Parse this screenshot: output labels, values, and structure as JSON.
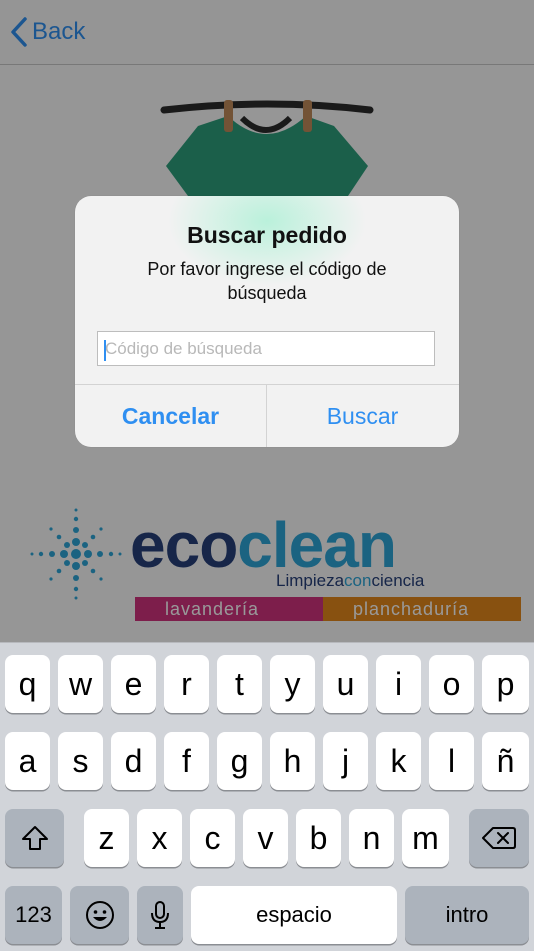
{
  "nav": {
    "back_label": "Back"
  },
  "brand": {
    "eco": "eco",
    "clean": "clean",
    "tagline_a": "Limpieza",
    "tagline_b": "con",
    "tagline_c": "ciencia",
    "band_left": "lavandería",
    "band_right": "planchaduría",
    "colors": {
      "navy": "#27407a",
      "cyan": "#2ea6d8",
      "magenta": "#d1337e",
      "orange": "#e3871c"
    }
  },
  "alert": {
    "title": "Buscar pedido",
    "message": "Por favor ingrese el código de búsqueda",
    "input_value": "",
    "input_placeholder": "Código de búsqueda",
    "cancel_label": "Cancelar",
    "search_label": "Buscar",
    "accent_color": "#2f8ff1"
  },
  "keyboard": {
    "row1": [
      "q",
      "w",
      "e",
      "r",
      "t",
      "y",
      "u",
      "i",
      "o",
      "p"
    ],
    "row2": [
      "a",
      "s",
      "d",
      "f",
      "g",
      "h",
      "j",
      "k",
      "l",
      "ñ"
    ],
    "row3": [
      "z",
      "x",
      "c",
      "v",
      "b",
      "n",
      "m"
    ],
    "numbers_label": "123",
    "space_label": "espacio",
    "return_label": "intro",
    "icons": [
      "shift-icon",
      "backspace-icon",
      "emoji-icon",
      "microphone-icon"
    ]
  }
}
